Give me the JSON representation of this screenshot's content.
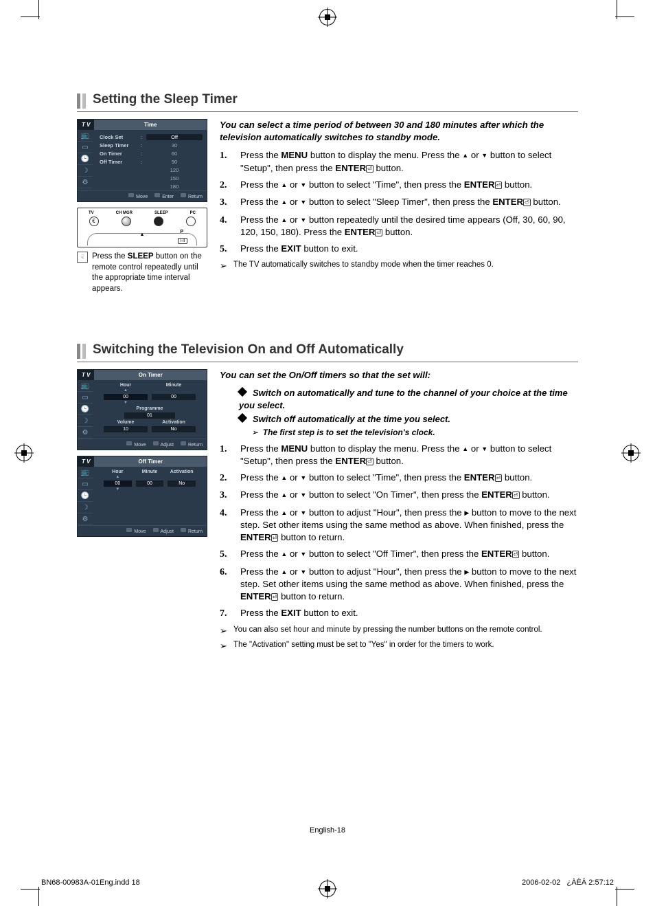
{
  "section1": {
    "title": "Setting the Sleep Timer",
    "intro": "You can select a time period of between 30 and 180 minutes after which the television automatically switches to standby mode.",
    "steps": [
      {
        "n": "1.",
        "pre": "Press the ",
        "b1": "MENU",
        "mid1": " button to display the menu. Press the ",
        "tri": "▲ or ▼",
        "mid2": " button to select \"Setup\", then press the ",
        "b2": "ENTER",
        "post": " button."
      },
      {
        "n": "2.",
        "pre": "Press the ",
        "tri": "▲ or ▼",
        "mid2": " button to select \"Time\", then press the ",
        "b2": "ENTER",
        "post": " button."
      },
      {
        "n": "3.",
        "pre": "Press the ",
        "tri": "▲ or ▼",
        "mid2": " button to select \"Sleep Timer\", then press the ",
        "b2": "ENTER",
        "post": " button."
      },
      {
        "n": "4.",
        "pre": "Press the ",
        "tri": "▲ or ▼",
        "mid2": " button repeatedly until the desired time appears (Off, 30, 60, 90, 120, 150, 180). Press the ",
        "b2": "ENTER",
        "post": " button."
      },
      {
        "n": "5.",
        "pre": "Press the ",
        "b1": "EXIT",
        "post": " button to exit."
      }
    ],
    "note": "The TV automatically switches to standby mode when the timer reaches 0.",
    "tip_pre": "Press the ",
    "tip_bold": "SLEEP",
    "tip_post": " button on the remote control repeatedly until the appropriate time interval appears.",
    "osd": {
      "tv": "T V",
      "title": "Time",
      "rows": [
        {
          "label": "Clock Set",
          "value": "Off",
          "sel": true
        },
        {
          "label": "Sleep Timer",
          "value": "30"
        },
        {
          "label": "On Timer",
          "value": "60"
        },
        {
          "label": "Off Timer",
          "value": "90"
        },
        {
          "label": "",
          "value": "120"
        },
        {
          "label": "",
          "value": "150"
        },
        {
          "label": "",
          "value": "180"
        }
      ],
      "footer": [
        "Move",
        "Enter",
        "Return"
      ]
    },
    "remote": {
      "labels": [
        "TV",
        "CH MGR",
        "SLEEP",
        "PC"
      ],
      "plabel": "P",
      "ii": "I-II"
    }
  },
  "section2": {
    "title": "Switching the Television On and Off Automatically",
    "intro": "You can set the On/Off timers so that the set will:",
    "bullets": [
      "Switch on automatically and tune to the channel of your choice at the time you select.",
      "Switch off automatically at the time you select."
    ],
    "subnote": "The first step is to set the television's clock.",
    "steps": [
      {
        "n": "1.",
        "pre": "Press the ",
        "b1": "MENU",
        "mid1": " button to display the menu. Press the ",
        "tri": "▲ or ▼",
        "mid2": " button to select \"Setup\", then press the ",
        "b2": "ENTER",
        "post": " button."
      },
      {
        "n": "2.",
        "pre": "Press the ",
        "tri": "▲ or ▼",
        "mid2": " button to select \"Time\", then press the ",
        "b2": "ENTER",
        "post": " button."
      },
      {
        "n": "3.",
        "pre": "Press the ",
        "tri": "▲ or ▼",
        "mid2": " button to select \"On Timer\", then press the ",
        "b2": "ENTER",
        "post": " button."
      },
      {
        "n": "4.",
        "pre": "Press the ",
        "tri": "▲ or ▼",
        "mid2": " button to adjust \"Hour\", then press the ",
        "rtri": "▶",
        "mid3": " button to move to the next step. Set other items using the same method as above. When finished, press the ",
        "b2": "ENTER",
        "post": " button to return."
      },
      {
        "n": "5.",
        "pre": "Press the ",
        "tri": "▲ or ▼",
        "mid2": " button to select \"Off Timer\", then press the ",
        "b2": "ENTER",
        "post": " button."
      },
      {
        "n": "6.",
        "pre": "Press the ",
        "tri": "▲ or ▼",
        "mid2": " button to adjust \"Hour\", then press the ",
        "rtri": "▶",
        "mid3": " button to move to the next step. Set other items using the same method as above. When finished, press the ",
        "b2": "ENTER",
        "post": " button to return."
      },
      {
        "n": "7.",
        "pre": "Press the ",
        "b1": "EXIT",
        "post": " button to exit."
      }
    ],
    "notes": [
      "You can also set hour and minute by pressing the number buttons on the remote control.",
      "The \"Activation\" setting must be set to \"Yes\" in order for the timers to work."
    ],
    "osd_on": {
      "tv": "T V",
      "title": "On Timer",
      "headers1": [
        "Hour",
        "Minute"
      ],
      "vals1": [
        "00",
        "00"
      ],
      "prog_label": "Programme",
      "prog_val": "01",
      "headers2": [
        "Volume",
        "Activation"
      ],
      "vals2": [
        "10",
        "No"
      ],
      "footer": [
        "Move",
        "Adjust",
        "Return"
      ]
    },
    "osd_off": {
      "tv": "T V",
      "title": "Off Timer",
      "headers": [
        "Hour",
        "Minute",
        "Activation"
      ],
      "vals": [
        "00",
        "00",
        "No"
      ],
      "footer": [
        "Move",
        "Adjust",
        "Return"
      ]
    }
  },
  "page_number": "English-18",
  "doc_foot_left": "BN68-00983A-01Eng.indd   18",
  "doc_foot_date": "2006-02-02",
  "doc_foot_time": "¿ÀÈÄ 2:57:12"
}
